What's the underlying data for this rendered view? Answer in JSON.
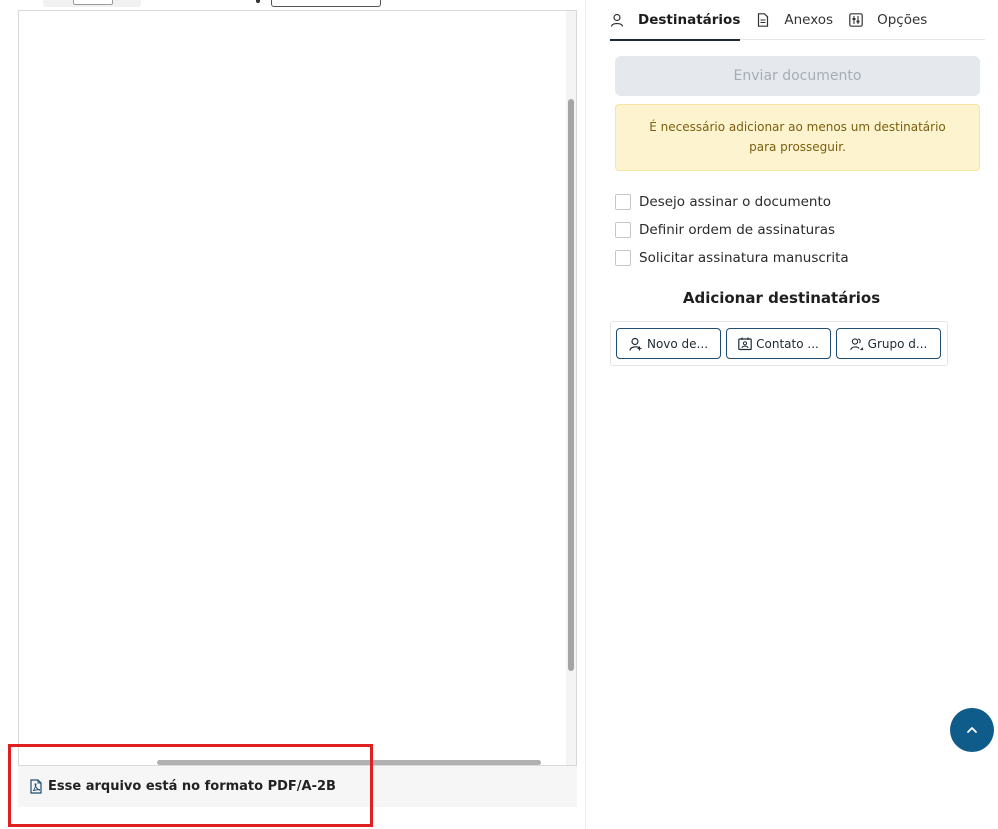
{
  "viewer": {
    "footer_label": "Esse arquivo está no formato PDF/A-2B"
  },
  "tabs": [
    {
      "label": "Destinatários",
      "icon": "user-icon",
      "active": true
    },
    {
      "label": "Anexos",
      "icon": "document-icon",
      "active": false
    },
    {
      "label": "Opções",
      "icon": "sliders-icon",
      "active": false
    }
  ],
  "send_button": {
    "label": "Enviar documento",
    "disabled": true
  },
  "warning": {
    "text": "É necessário adicionar ao menos um destinatário para prosseguir."
  },
  "options": [
    {
      "label": "Desejo assinar o documento",
      "checked": false
    },
    {
      "label": "Definir ordem de assinaturas",
      "checked": false
    },
    {
      "label": "Solicitar assinatura manuscrita",
      "checked": false
    }
  ],
  "add_recipients": {
    "title": "Adicionar destinatários",
    "buttons": [
      {
        "label": "Novo de...",
        "icon": "user-plus-icon"
      },
      {
        "label": "Contato ...",
        "icon": "contact-card-icon"
      },
      {
        "label": "Grupo d...",
        "icon": "group-icon"
      }
    ]
  },
  "colors": {
    "accent": "#0f5b8a",
    "button_border": "#1e4d70",
    "warning_bg": "#fdf4cf",
    "warning_text": "#7a5f10",
    "highlight": "#e02020",
    "disabled_bg": "#e5e8ed"
  }
}
